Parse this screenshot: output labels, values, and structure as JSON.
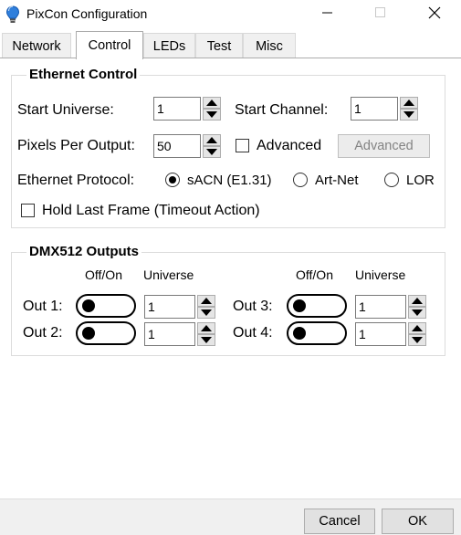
{
  "window": {
    "title": "PixCon Configuration",
    "minimize_icon": "minimize-icon",
    "maximize_icon": "maximize-icon",
    "close_icon": "close-icon",
    "app_icon": "lightbulb-icon",
    "app_icon_color": "#1e6fd0"
  },
  "tabs": [
    {
      "label": "Network",
      "active": false
    },
    {
      "label": "Control",
      "active": true
    },
    {
      "label": "LEDs",
      "active": false
    },
    {
      "label": "Test",
      "active": false
    },
    {
      "label": "Misc",
      "active": false
    }
  ],
  "ethernet": {
    "title": "Ethernet Control",
    "start_universe_label": "Start Universe:",
    "start_universe_value": "1",
    "start_channel_label": "Start Channel:",
    "start_channel_value": "1",
    "pixels_per_output_label": "Pixels Per Output:",
    "pixels_per_output_value": "50",
    "advanced_checkbox_label": "Advanced",
    "advanced_checked": false,
    "advanced_button_label": "Advanced",
    "advanced_button_enabled": false,
    "protocol_label": "Ethernet Protocol:",
    "protocols": [
      {
        "label": "sACN (E1.31)",
        "checked": true
      },
      {
        "label": "Art-Net",
        "checked": false
      },
      {
        "label": "LOR",
        "checked": false
      }
    ],
    "hold_last_frame_label": "Hold Last Frame (Timeout Action)",
    "hold_last_frame_checked": false
  },
  "dmx": {
    "title": "DMX512 Outputs",
    "col_offon": "Off/On",
    "col_universe": "Universe",
    "outputs": [
      {
        "label": "Out 1:",
        "on": false,
        "universe": "1"
      },
      {
        "label": "Out 2:",
        "on": false,
        "universe": "1"
      },
      {
        "label": "Out 3:",
        "on": false,
        "universe": "1"
      },
      {
        "label": "Out 4:",
        "on": false,
        "universe": "1"
      }
    ]
  },
  "footer": {
    "cancel_label": "Cancel",
    "ok_label": "OK"
  }
}
